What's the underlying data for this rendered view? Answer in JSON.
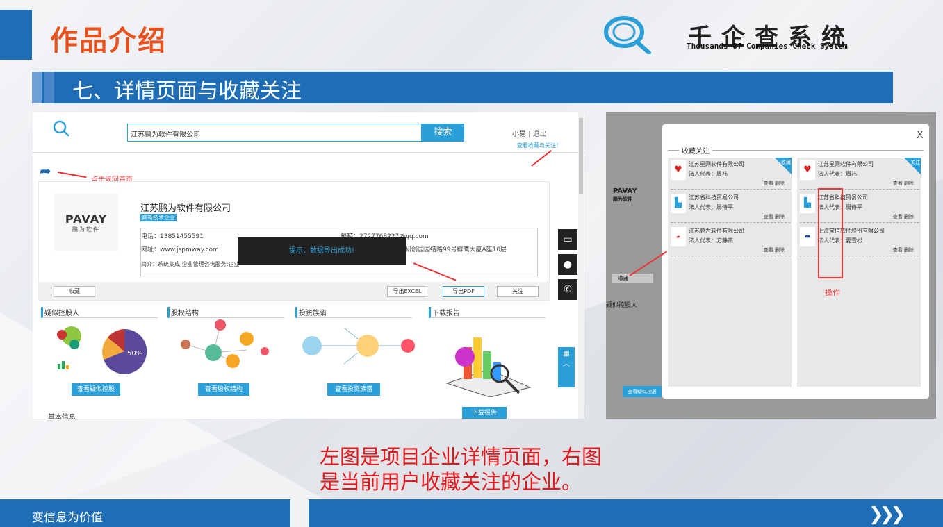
{
  "slide": {
    "title": "作品介绍",
    "section": "七、详情页面与收藏关注",
    "caption_line1": "左图是项目企业详情页面，右图",
    "caption_line2": "是当前用户收藏关注的企业。",
    "slogan": "变信息为价值"
  },
  "brand": {
    "cn": "千企查系统",
    "en": "Thousands Of Companies Check System"
  },
  "detail": {
    "search_value": "江苏鹏为软件有限公司",
    "search_btn": "搜索",
    "user": "小易",
    "sep": "|",
    "logout": "退出",
    "view_fav": "查看收藏与关注！",
    "back_hint": "点击返回首页",
    "company": "江苏鹏为软件有限公司",
    "tag": "高新技术企业",
    "logo_text": "PAVAY",
    "logo_sub": "鹏为软件",
    "phone": "电话：13851455591",
    "email": "邮箱：2727768227@qq.com",
    "website": "网址：www.jspmway.com",
    "address": "研创园园结路99号孵鹰大厦A座10层",
    "intro": "简介：系统集成;企业管理咨询服务;企业",
    "toast": "提示：数据导出成功!",
    "btn_fav": "收藏",
    "btn_excel": "导出EXCEL",
    "btn_pdf": "导出PDF",
    "btn_follow": "关注",
    "panels": [
      {
        "title": "疑似控股人",
        "btn": "查看疑似控股",
        "pct": "50%"
      },
      {
        "title": "股权结构",
        "btn": "查看股权结构"
      },
      {
        "title": "投资族谱",
        "btn": "查看投资族谱"
      },
      {
        "title": "下载报告",
        "btn": "下载报告"
      }
    ],
    "basic": "基本信息"
  },
  "favorites": {
    "title": "收藏关注",
    "close": "X",
    "corner_left": "收藏",
    "corner_right": "关注",
    "op_label": "操作",
    "act": "查看  删除",
    "law_prefix": "法人代表：",
    "left": [
      {
        "name": "江苏星网软件有限公司",
        "law": "周祎"
      },
      {
        "name": "江苏省科技贸易公司",
        "law": "周侍平"
      },
      {
        "name": "江苏鹏为软件有限公司",
        "law": "方静燕"
      }
    ],
    "right": [
      {
        "name": "江苏星网软件有限公司",
        "law": "周祎"
      },
      {
        "name": "江苏省科技贸易公司",
        "law": "周侍平"
      },
      {
        "name": "上海宝信软件股份有限公司",
        "law": "夏雪松"
      }
    ],
    "bg_fav": "收藏",
    "bg_panel": "疑似控股人",
    "bg_btn": "查看疑似控股"
  }
}
